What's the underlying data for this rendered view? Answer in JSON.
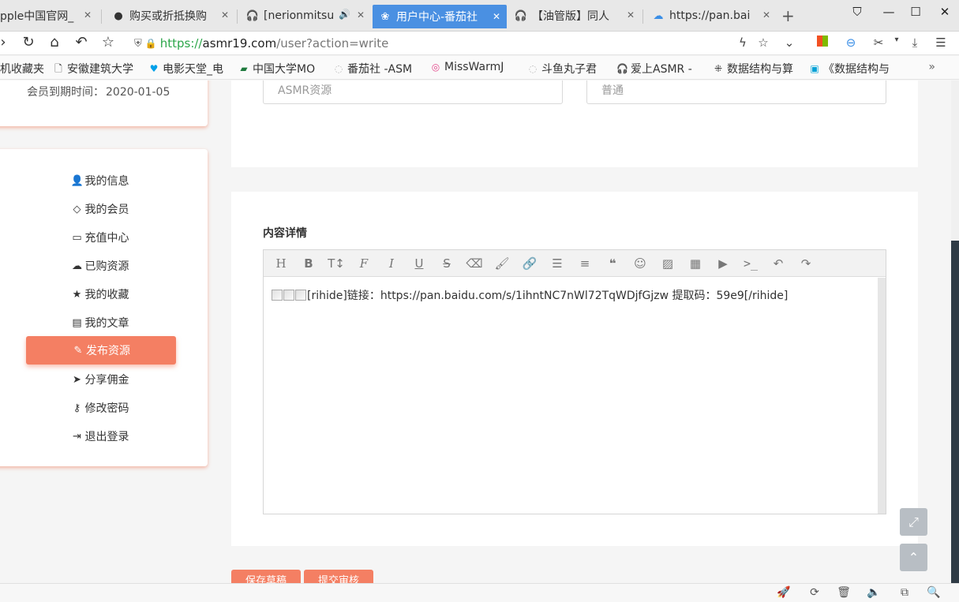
{
  "browser": {
    "tabs": [
      {
        "label": "pple中国官网_",
        "icon": "apple-icon"
      },
      {
        "label": "购买或折抵换购",
        "icon": "apple-icon"
      },
      {
        "label": "[nerionmitsu",
        "icon": "headphones-icon"
      },
      {
        "label": "用户中心-番茄社",
        "icon": "site-icon"
      },
      {
        "label": "【油管版】同人",
        "icon": "headphones-icon"
      },
      {
        "label": "https://pan.bai",
        "icon": "baidu-cloud-icon"
      }
    ],
    "active_tab": 3,
    "url_proto": "https://",
    "url_host": "asmr19.com",
    "url_path": "/user?action=write",
    "bookmarks": [
      "机收藏夹",
      "安徽建筑大学",
      "电影天堂_电",
      "中国大学MO",
      "番茄社 -ASM",
      "MissWarmJ",
      "斗鱼丸子君",
      "爱上ASMR -",
      "数据结构与算",
      "《数据结构与"
    ]
  },
  "member": {
    "expire_label": "会员到期时间：",
    "expire_date": "2020-01-05"
  },
  "menu": {
    "items": [
      {
        "label": "我的信息",
        "icon": "user-icon"
      },
      {
        "label": "我的会员",
        "icon": "diamond-icon"
      },
      {
        "label": "充值中心",
        "icon": "credit-card-icon"
      },
      {
        "label": "已购资源",
        "icon": "cloud-download-icon"
      },
      {
        "label": "我的收藏",
        "icon": "star-icon"
      },
      {
        "label": "我的文章",
        "icon": "file-icon"
      },
      {
        "label": "发布资源",
        "icon": "pencil-icon"
      },
      {
        "label": "分享佣金",
        "icon": "paper-plane-icon"
      },
      {
        "label": "修改密码",
        "icon": "key-icon"
      },
      {
        "label": "退出登录",
        "icon": "sign-out-icon"
      }
    ],
    "active": 6
  },
  "form": {
    "category_value": "ASMR资源",
    "level_value": "普通",
    "content_title": "内容详情",
    "editor_content": "[rihide]链接：https://pan.baidu.com/s/1ihntNC7nWl72TqWDjfGjzw 提取码：59e9[/rihide]",
    "save_label": "保存草稿",
    "submit_label": "提交审核"
  },
  "colors": {
    "accent": "#f47f63",
    "active_tab": "#4a90e2",
    "url_green": "#2ca64a"
  }
}
